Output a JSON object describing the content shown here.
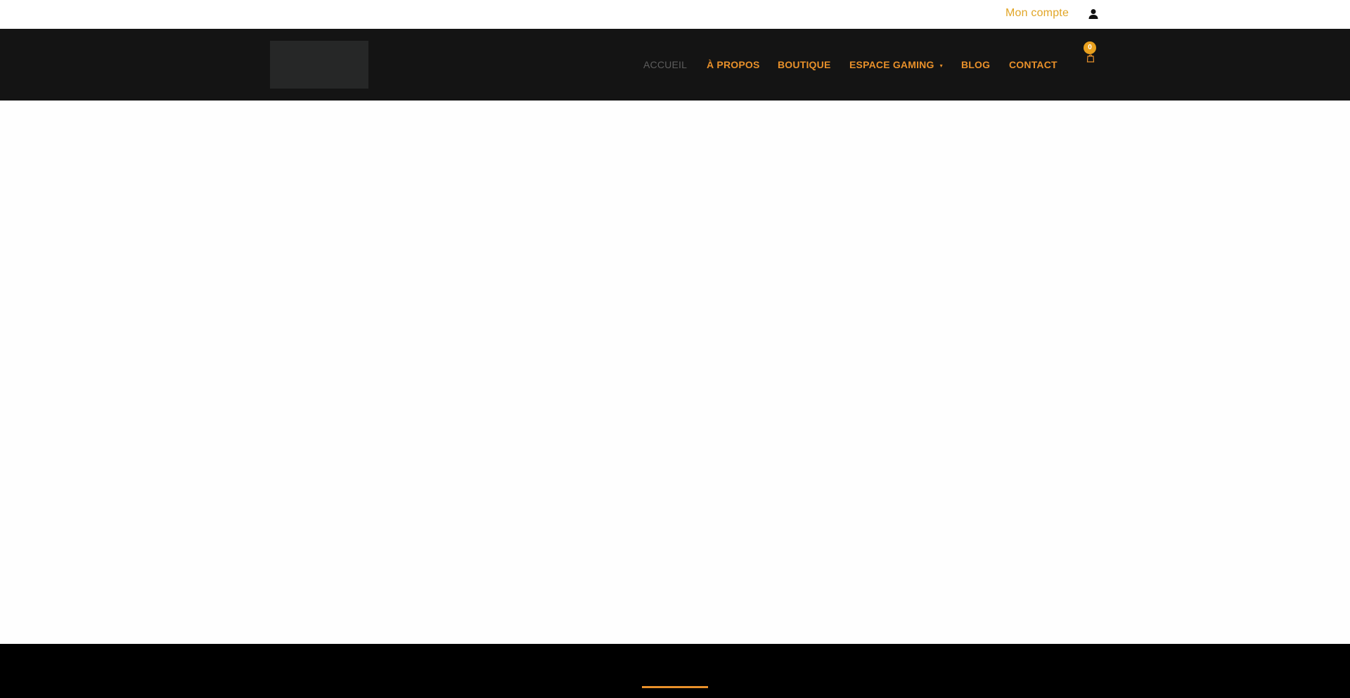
{
  "topbar": {
    "account_label": "Mon compte",
    "account_icon": "user-icon"
  },
  "header": {
    "nav": [
      {
        "label": "ACCUEIL",
        "active": true
      },
      {
        "label": "À PROPOS",
        "active": false
      },
      {
        "label": "BOUTIQUE",
        "active": false
      },
      {
        "label": "ESPACE GAMING",
        "active": false,
        "has_dropdown": true,
        "dropdown_icon": "chevron-down-icon"
      },
      {
        "label": "BLOG",
        "active": false
      },
      {
        "label": "CONTACT",
        "active": false
      }
    ],
    "cart": {
      "count": "0",
      "icon": "cart-icon"
    }
  },
  "colors": {
    "accent": "#e8902a",
    "account_link": "#e1a526",
    "header_bg": "#141414",
    "footer_bg": "#000000",
    "active_nav": "#5d5d5d"
  }
}
